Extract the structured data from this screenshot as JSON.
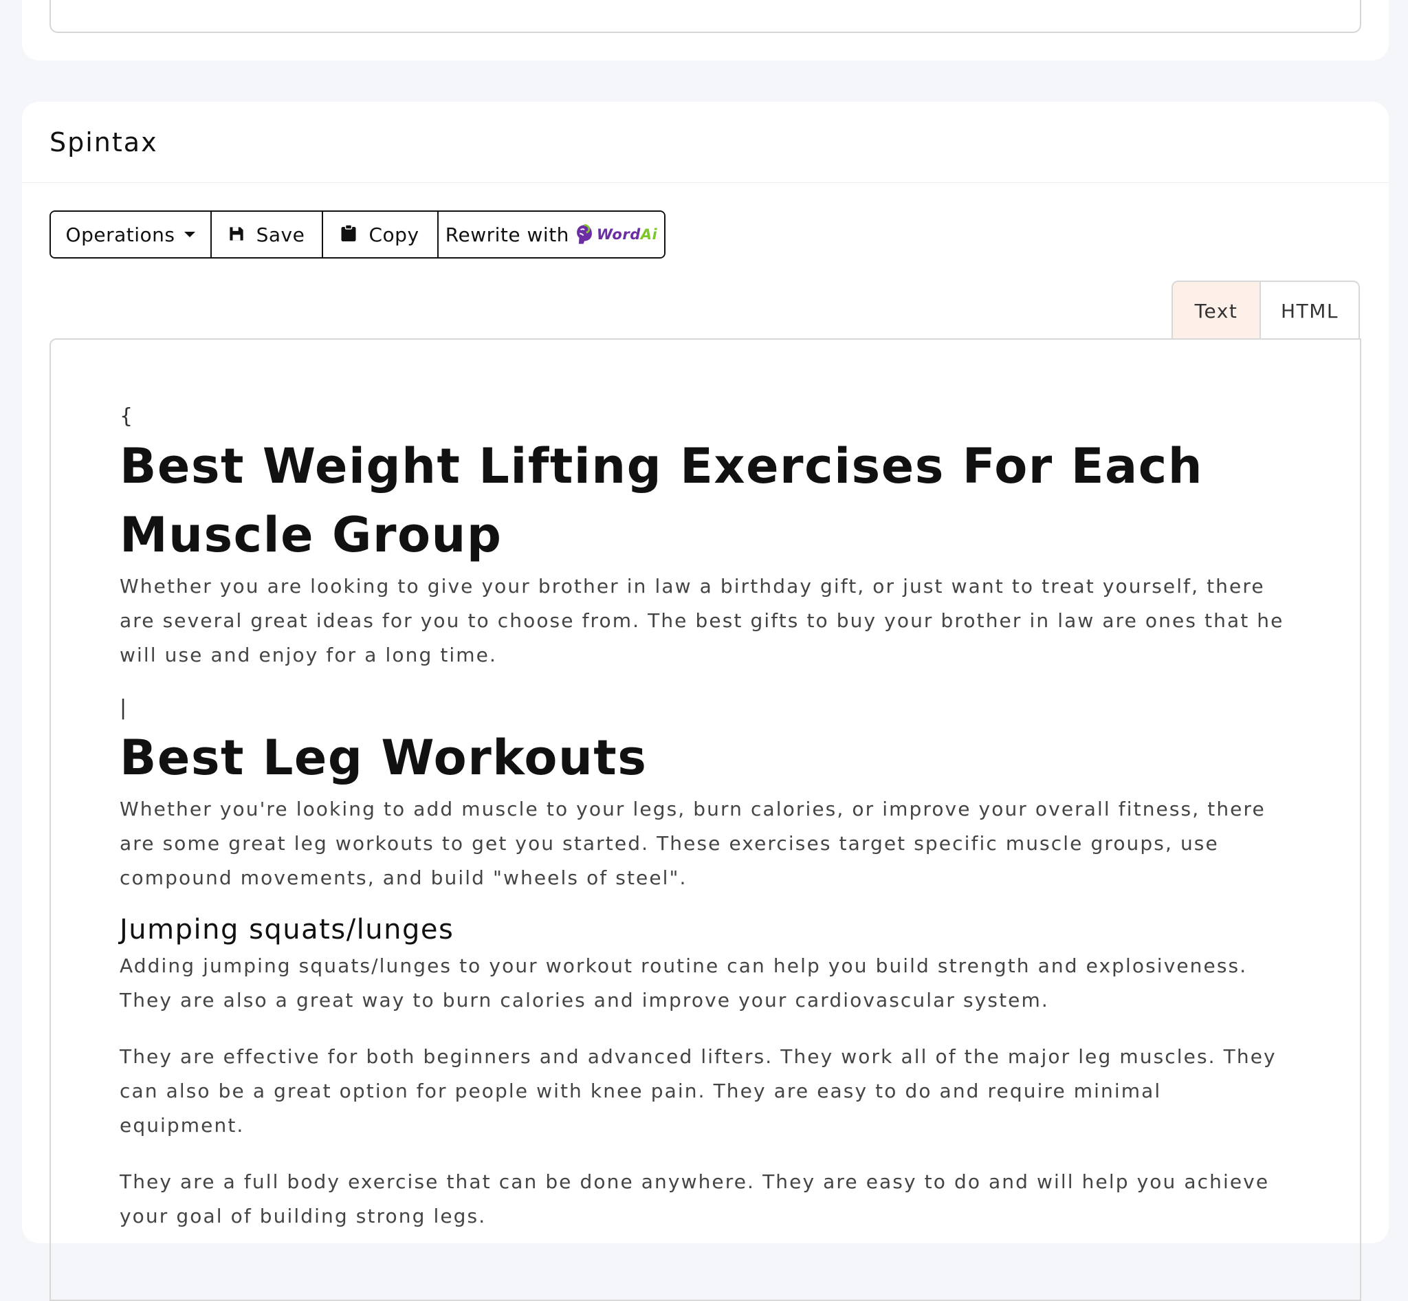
{
  "card": {
    "title": "Spintax"
  },
  "toolbar": {
    "operations_label": "Operations",
    "save_label": "Save",
    "copy_label": "Copy",
    "rewrite_label": "Rewrite with",
    "brand_word": "Word",
    "brand_ai": "Ai"
  },
  "tabs": {
    "text_label": "Text",
    "html_label": "HTML"
  },
  "editor": {
    "open_brace": "{",
    "pipe": "|",
    "heading1": "Best Weight Lifting Exercises For Each Muscle Group",
    "para1": "Whether you are looking to give your brother in law a birthday gift, or just want to treat yourself, there are several great ideas for you to choose from. The best gifts to buy your brother in law are ones that he will use and enjoy for a long time.",
    "heading2": "Best Leg Workouts",
    "para2": "Whether you're looking to add muscle to your legs, burn calories, or improve your overall fitness, there are some great leg workouts to get you started. These exercises target specific muscle groups, use compound movements, and build \"wheels of steel\".",
    "subheading": "Jumping squats/lunges",
    "para3": "Adding jumping squats/lunges to your workout routine can help you build strength and explosiveness. They are also a great way to burn calories and improve your cardiovascular system.",
    "para4": "They are effective for both beginners and advanced lifters. They work all of the major leg muscles. They can also be a great option for people with knee pain. They are easy to do and require minimal equipment.",
    "para5": "They are a full body exercise that can be done anywhere. They are easy to do and will help you achieve your goal of building strong legs."
  }
}
